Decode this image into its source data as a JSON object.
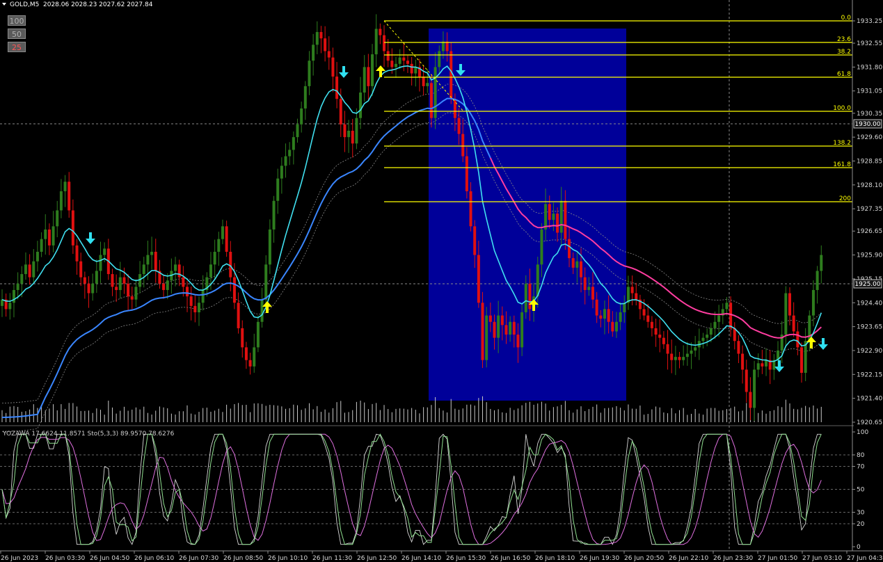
{
  "header": {
    "symbol": "GOLD,M5",
    "ohlc": "2028.06 2028.23 2027.62 2027.84"
  },
  "buttons": [
    "100",
    "50",
    "25"
  ],
  "colors": {
    "background": "#000000",
    "bull_candle": "#2e7d1e",
    "bear_candle": "#e01010",
    "fib_line": "#ffff00",
    "fast_ma": "#40e0f0",
    "slow_ma": "#3a86ff",
    "long_ma": "#ff3da0",
    "highlight": "#000099",
    "up_arrow": "#ffff00",
    "down_arrow": "#30e0f0"
  },
  "price_axis": [
    "1933.25",
    "1932.55",
    "1931.80",
    "1931.05",
    "1930.35",
    "1929.60",
    "1928.85",
    "1928.10",
    "1927.35",
    "1926.65",
    "1925.90",
    "1925.15",
    "1924.40",
    "1923.65",
    "1922.90",
    "1922.15",
    "1921.40",
    "1920.65"
  ],
  "price_markers": {
    "upper": "1930.00",
    "lower": "1925.00"
  },
  "time_axis": [
    "26 Jun 2023",
    "26 Jun 03:30",
    "26 Jun 04:50",
    "26 Jun 06:10",
    "26 Jun 07:30",
    "26 Jun 08:50",
    "26 Jun 10:10",
    "26 Jun 11:30",
    "26 Jun 12:50",
    "26 Jun 14:10",
    "26 Jun 15:30",
    "26 Jun 16:50",
    "26 Jun 18:10",
    "26 Jun 19:30",
    "26 Jun 20:50",
    "26 Jun 22:10",
    "26 Jun 23:30",
    "27 Jun 01:50",
    "27 Jun 03:10",
    "27 Jun 04:30"
  ],
  "fib_levels": [
    "0.0",
    "23.6",
    "38.2",
    "61.8",
    "100.0",
    "138.2",
    "161.8",
    "200"
  ],
  "oscillator": {
    "label": "YOZAWA 17.6624 11.8571  Sto(5,3,3) 89.9570 78.6276",
    "axis": [
      "100",
      "80",
      "70",
      "50",
      "30",
      "20",
      "0"
    ]
  },
  "chart_data": {
    "type": "candlestick",
    "symbol": "GOLD",
    "timeframe": "M5",
    "ylim": [
      1920.65,
      1933.25
    ],
    "fib_levels": {
      "0.0": 1933.25,
      "23.6": 1932.6,
      "38.2": 1932.3,
      "61.8": 1931.8,
      "100.0": 1930.6,
      "138.2": 1929.7,
      "161.8": 1929.1,
      "200": 1928.0
    },
    "close_series": [
      1924.5,
      1924.2,
      1924.4,
      1924.8,
      1925.0,
      1925.3,
      1925.6,
      1925.2,
      1925.7,
      1926.0,
      1926.4,
      1926.7,
      1926.2,
      1926.8,
      1927.3,
      1927.9,
      1928.2,
      1927.3,
      1926.2,
      1925.7,
      1925.2,
      1925.0,
      1924.7,
      1925.0,
      1925.4,
      1925.9,
      1926.1,
      1925.3,
      1924.9,
      1924.8,
      1925.2,
      1925.0,
      1924.6,
      1924.5,
      1924.9,
      1925.3,
      1925.6,
      1925.9,
      1926.0,
      1925.4,
      1925.0,
      1924.8,
      1925.1,
      1925.4,
      1925.6,
      1925.2,
      1924.9,
      1924.6,
      1924.3,
      1924.1,
      1924.4,
      1924.8,
      1925.2,
      1925.6,
      1926.0,
      1926.4,
      1926.8,
      1926.0,
      1925.2,
      1924.4,
      1923.6,
      1923.0,
      1922.6,
      1922.4,
      1923.0,
      1923.8,
      1924.5,
      1925.6,
      1926.7,
      1927.6,
      1928.3,
      1928.7,
      1929.0,
      1929.2,
      1929.6,
      1930.0,
      1930.5,
      1931.2,
      1932.0,
      1932.5,
      1932.9,
      1932.7,
      1932.3,
      1932.1,
      1931.5,
      1930.8,
      1930.0,
      1929.6,
      1929.8,
      1929.4,
      1930.2,
      1931.0,
      1931.8,
      1931.2,
      1932.2,
      1933.0,
      1932.8,
      1932.3,
      1932.0,
      1931.8,
      1931.9,
      1932.1,
      1932.0,
      1931.9,
      1931.6,
      1931.8,
      1931.5,
      1931.2,
      1931.3,
      1930.2,
      1931.8,
      1932.3,
      1932.6,
      1932.3,
      1930.8,
      1930.2,
      1929.7,
      1929.0,
      1927.9,
      1926.8,
      1925.9,
      1924.4,
      1922.6,
      1924.0,
      1923.8,
      1923.3,
      1924.0,
      1923.7,
      1923.4,
      1923.8,
      1923.4,
      1923.0,
      1924.1,
      1925.0,
      1924.2,
      1924.6,
      1925.6,
      1926.7,
      1927.5,
      1927.0,
      1927.2,
      1926.6,
      1927.6,
      1926.4,
      1925.8,
      1925.5,
      1925.7,
      1925.2,
      1924.8,
      1924.9,
      1924.5,
      1924.0,
      1923.9,
      1924.2,
      1923.8,
      1923.5,
      1923.8,
      1924.1,
      1924.4,
      1924.9,
      1924.7,
      1924.5,
      1924.2,
      1924.0,
      1923.8,
      1923.6,
      1923.4,
      1923.3,
      1923.1,
      1922.8,
      1922.6,
      1922.7,
      1922.6,
      1922.7,
      1922.8,
      1922.9,
      1923.0,
      1923.2,
      1923.3,
      1923.4,
      1923.6,
      1923.8,
      1924.0,
      1924.2,
      1924.4,
      1923.6,
      1923.2,
      1922.8,
      1922.3,
      1921.6,
      1921.1,
      1922.3,
      1922.5,
      1922.4,
      1922.6,
      1922.3,
      1922.6,
      1922.9,
      1923.4,
      1924.7,
      1924.0,
      1923.5,
      1923.0,
      1922.2,
      1923.2,
      1924.0,
      1924.8,
      1925.4,
      1925.9
    ]
  }
}
